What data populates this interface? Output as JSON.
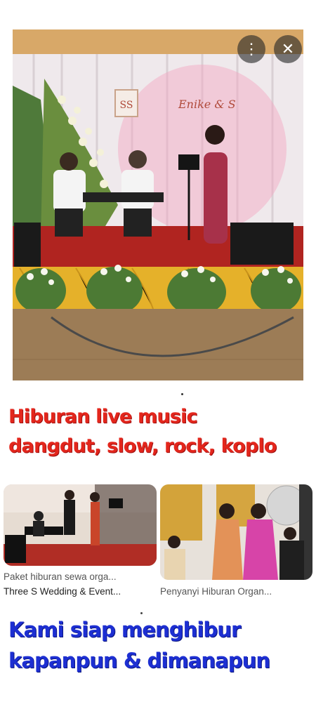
{
  "status_bar": {
    "left_text": "",
    "right_text": ""
  },
  "overlay": {
    "more_icon": "vertical-dots-icon",
    "close_icon": "close-icon",
    "more_glyph": "⋮",
    "close_glyph": "✕"
  },
  "main_photo": {
    "sign_monogram": "SS",
    "sign_names": "Enike & S",
    "colors": {
      "curtain": "#f2eef0",
      "stage": "#b0201a",
      "skirt": "#e8b52a",
      "floor": "#9a7a55"
    }
  },
  "caption_top": {
    "line1": "Hiburan live music",
    "line2": "dangdut, slow, rock, koplo"
  },
  "results": [
    {
      "title": "Paket hiburan sewa orga...",
      "source": "Three S Wedding & Event..."
    },
    {
      "title": "Penyanyi Hiburan Organ...",
      "source": ""
    }
  ],
  "caption_bottom": {
    "line1": "Kami siap menghibur",
    "line2": "kapanpun & dimanapun"
  }
}
